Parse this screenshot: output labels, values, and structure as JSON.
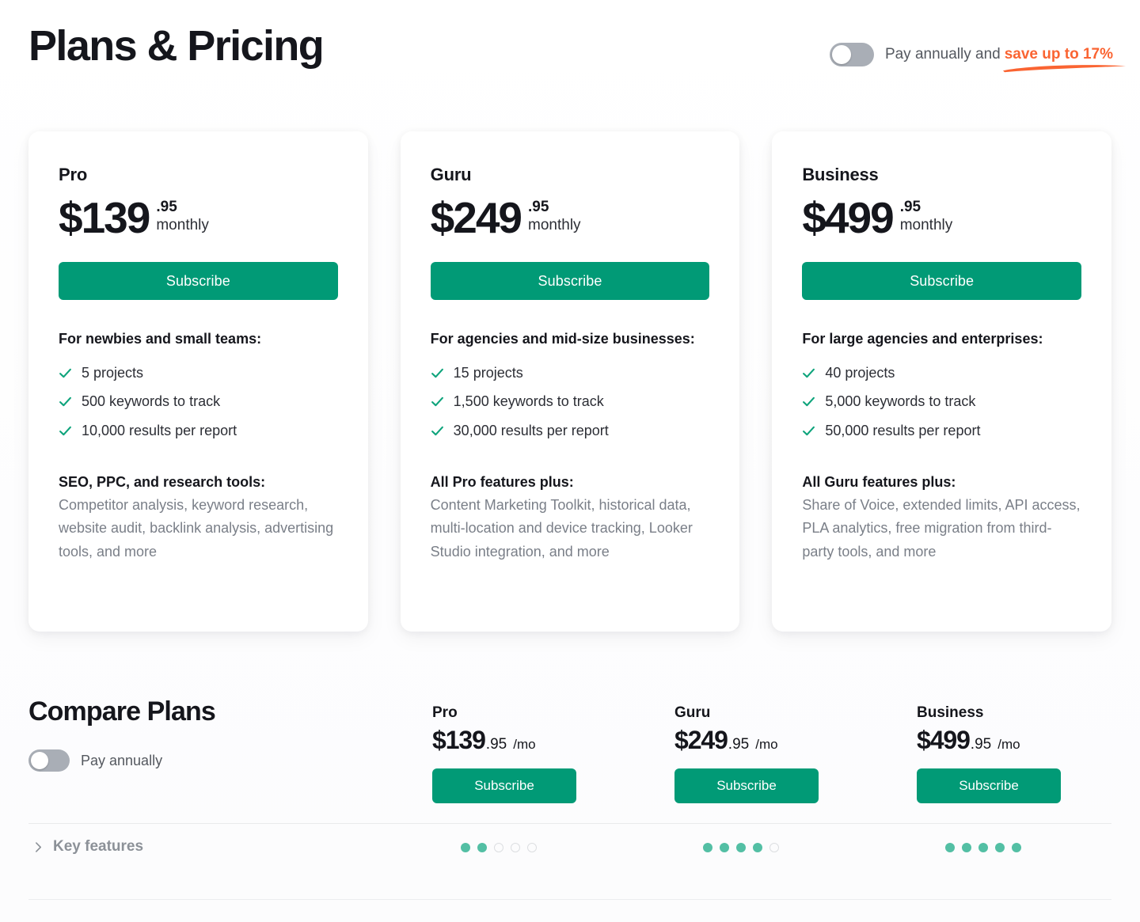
{
  "header": {
    "title": "Plans & Pricing",
    "annual_toggle": {
      "icon": "toggle-switch-off",
      "label": "Pay annually and",
      "promo": "save up to 17%",
      "state": "off"
    }
  },
  "colors": {
    "brand_green": "#019A76",
    "promo_orange": "#FA6432",
    "dot_teal": "#53BFA4",
    "toggle_track": "#A9AEB6"
  },
  "plans": [
    {
      "name": "Pro",
      "price_main": "$139",
      "price_cents": ".95",
      "price_period": "monthly",
      "cta": "Subscribe",
      "audience_title": "For newbies and small teams:",
      "features": [
        "5 projects",
        "500 keywords to track",
        "10,000 results per report"
      ],
      "extra_title": "SEO, PPC, and research tools:",
      "extra_body": "Competitor analysis, keyword research, website audit, backlink analysis, advertising tools, and more"
    },
    {
      "name": "Guru",
      "price_main": "$249",
      "price_cents": ".95",
      "price_period": "monthly",
      "cta": "Subscribe",
      "audience_title": "For agencies and mid-size businesses:",
      "features": [
        "15 projects",
        "1,500 keywords to track",
        "30,000 results per report"
      ],
      "extra_title": "All Pro features plus:",
      "extra_body": "Content Marketing Toolkit, historical data, multi-location and device tracking, Looker Studio integration, and more"
    },
    {
      "name": "Business",
      "price_main": "$499",
      "price_cents": ".95",
      "price_period": "monthly",
      "cta": "Subscribe",
      "audience_title": "For large agencies and enterprises:",
      "features": [
        "40 projects",
        "5,000 keywords to track",
        "50,000 results per report"
      ],
      "extra_title": "All Guru features plus:",
      "extra_body": "Share of Voice, extended limits, API access, PLA analytics, free migration from third-party tools, and more"
    }
  ],
  "compare": {
    "title": "Compare Plans",
    "annual_toggle": {
      "icon": "toggle-switch-off",
      "label": "Pay annually",
      "state": "off"
    },
    "columns": [
      {
        "name": "Pro",
        "price_amount": "$139",
        "price_cents": ".95",
        "price_per": "/mo",
        "cta": "Subscribe",
        "dots_filled": 2,
        "dots_total": 5
      },
      {
        "name": "Guru",
        "price_amount": "$249",
        "price_cents": ".95",
        "price_per": "/mo",
        "cta": "Subscribe",
        "dots_filled": 4,
        "dots_total": 5
      },
      {
        "name": "Business",
        "price_amount": "$499",
        "price_cents": ".95",
        "price_per": "/mo",
        "cta": "Subscribe",
        "dots_filled": 5,
        "dots_total": 5
      }
    ],
    "rows": [
      {
        "label": "Key features",
        "expanded": false,
        "chevron": "chevron-right-icon"
      }
    ]
  }
}
